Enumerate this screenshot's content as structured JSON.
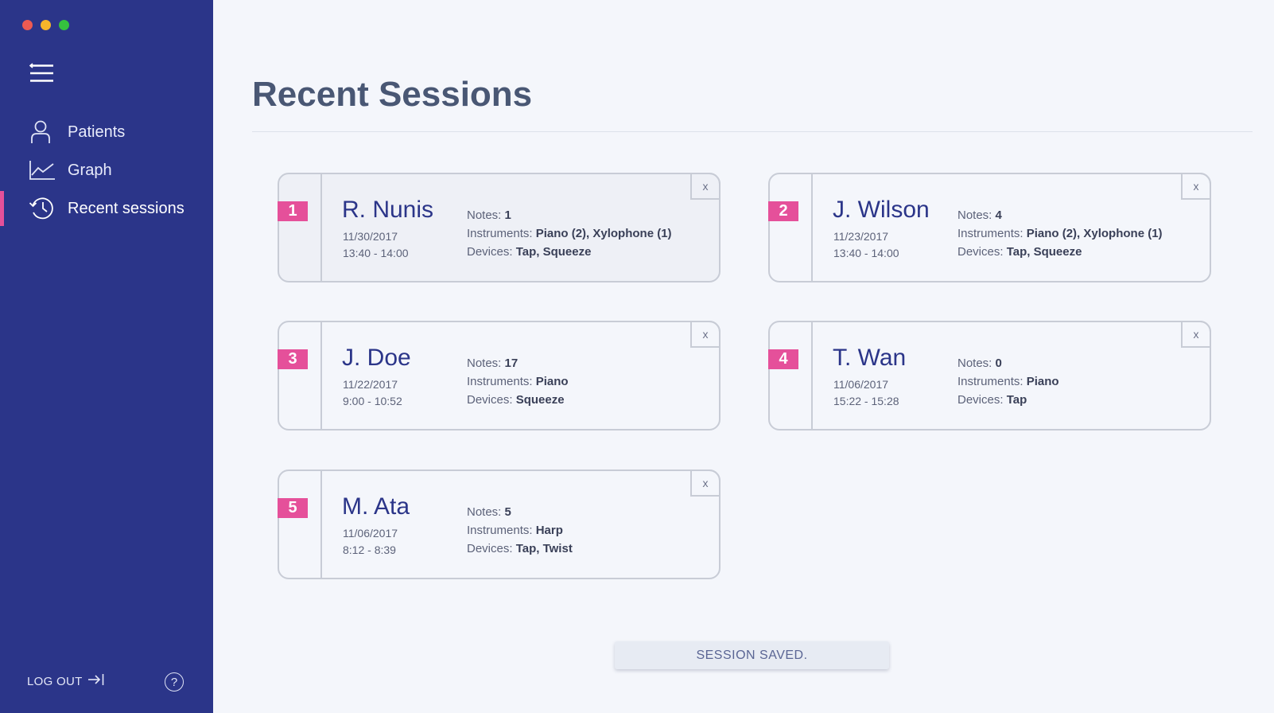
{
  "window": {
    "controls": [
      "close",
      "minimize",
      "zoom"
    ]
  },
  "sidebar": {
    "menu_icon": "hamburger-menu-icon",
    "items": [
      {
        "label": "Patients",
        "icon": "person-icon",
        "active": false
      },
      {
        "label": "Graph",
        "icon": "line-chart-icon",
        "active": false
      },
      {
        "label": "Recent sessions",
        "icon": "history-clock-icon",
        "active": true
      }
    ],
    "logout_label": "LOG OUT",
    "logout_icon": "logout-arrow-icon",
    "help_label": "?"
  },
  "main": {
    "title": "Recent Sessions",
    "labels": {
      "notes": "Notes:",
      "instruments": "Instruments:",
      "devices": "Devices:",
      "close": "x"
    },
    "sessions": [
      {
        "number": "1",
        "name": "R. Nunis",
        "date": "11/30/2017",
        "time": "13:40 - 14:00",
        "notes": "1",
        "instruments": "Piano (2), Xylophone (1)",
        "devices": "Tap, Squeeze"
      },
      {
        "number": "2",
        "name": "J. Wilson",
        "date": "11/23/2017",
        "time": "13:40 - 14:00",
        "notes": "4",
        "instruments": "Piano (2), Xylophone (1)",
        "devices": "Tap, Squeeze"
      },
      {
        "number": "3",
        "name": "J. Doe",
        "date": "11/22/2017",
        "time": "9:00 - 10:52",
        "notes": "17",
        "instruments": "Piano",
        "devices": "Squeeze"
      },
      {
        "number": "4",
        "name": "T. Wan",
        "date": "11/06/2017",
        "time": "15:22 - 15:28",
        "notes": "0",
        "instruments": "Piano",
        "devices": "Tap"
      },
      {
        "number": "5",
        "name": "M. Ata",
        "date": "11/06/2017",
        "time": "8:12 - 8:39",
        "notes": "5",
        "instruments": "Harp",
        "devices": "Tap, Twist"
      }
    ],
    "toast": "SESSION SAVED."
  },
  "colors": {
    "sidebar_bg": "#2b3589",
    "accent": "#e5509a",
    "background": "#f4f6fb",
    "name_text": "#2b3589"
  }
}
